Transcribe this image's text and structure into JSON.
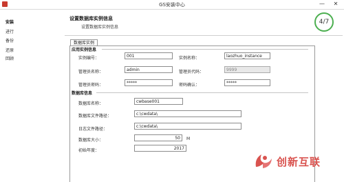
{
  "window": {
    "title": "GS安装中心",
    "minimize": "—",
    "close": "✕"
  },
  "sidebar": {
    "items": [
      {
        "label": "安装"
      },
      {
        "label": "进行"
      },
      {
        "label": "备份"
      },
      {
        "label": "还原"
      },
      {
        "label": "回顾"
      }
    ]
  },
  "header": {
    "title": "设置数据库实例信息",
    "subtitle": "设置数据库实例信息",
    "step": "4/7"
  },
  "tab": {
    "label": "数据库实例"
  },
  "app_group": {
    "title": "应用实例信息",
    "instance_no_label": "实例编号：",
    "instance_no": "001",
    "instance_name_label": "实例名称：",
    "instance_name": "laozhuo_instance",
    "admin_name_label": "管理员名称：",
    "admin_name": "admin",
    "admin_code_label": "管理员代码：",
    "admin_code": "9999",
    "admin_pwd_label": "管理员密码：",
    "admin_pwd": "*****",
    "confirm_pwd_label": "密码确认：",
    "confirm_pwd": "*****"
  },
  "db_group": {
    "title": "数据库信息",
    "db_name_label": "数据库名称：",
    "db_name": "cwbase001",
    "db_path_label": "数据库文件路径：",
    "db_path": "c:\\cwdata\\",
    "log_path_label": "日志文件路径：",
    "log_path": "c:\\cwdata\\",
    "db_size_label": "数据库大小：",
    "db_size": "50",
    "db_size_unit": "M",
    "init_year_label": "初始年度：",
    "init_year": "2017"
  },
  "watermark": {
    "text": "创新互联"
  },
  "colors": {
    "step_ring": "#4caf50",
    "watermark": "#d9534f"
  }
}
